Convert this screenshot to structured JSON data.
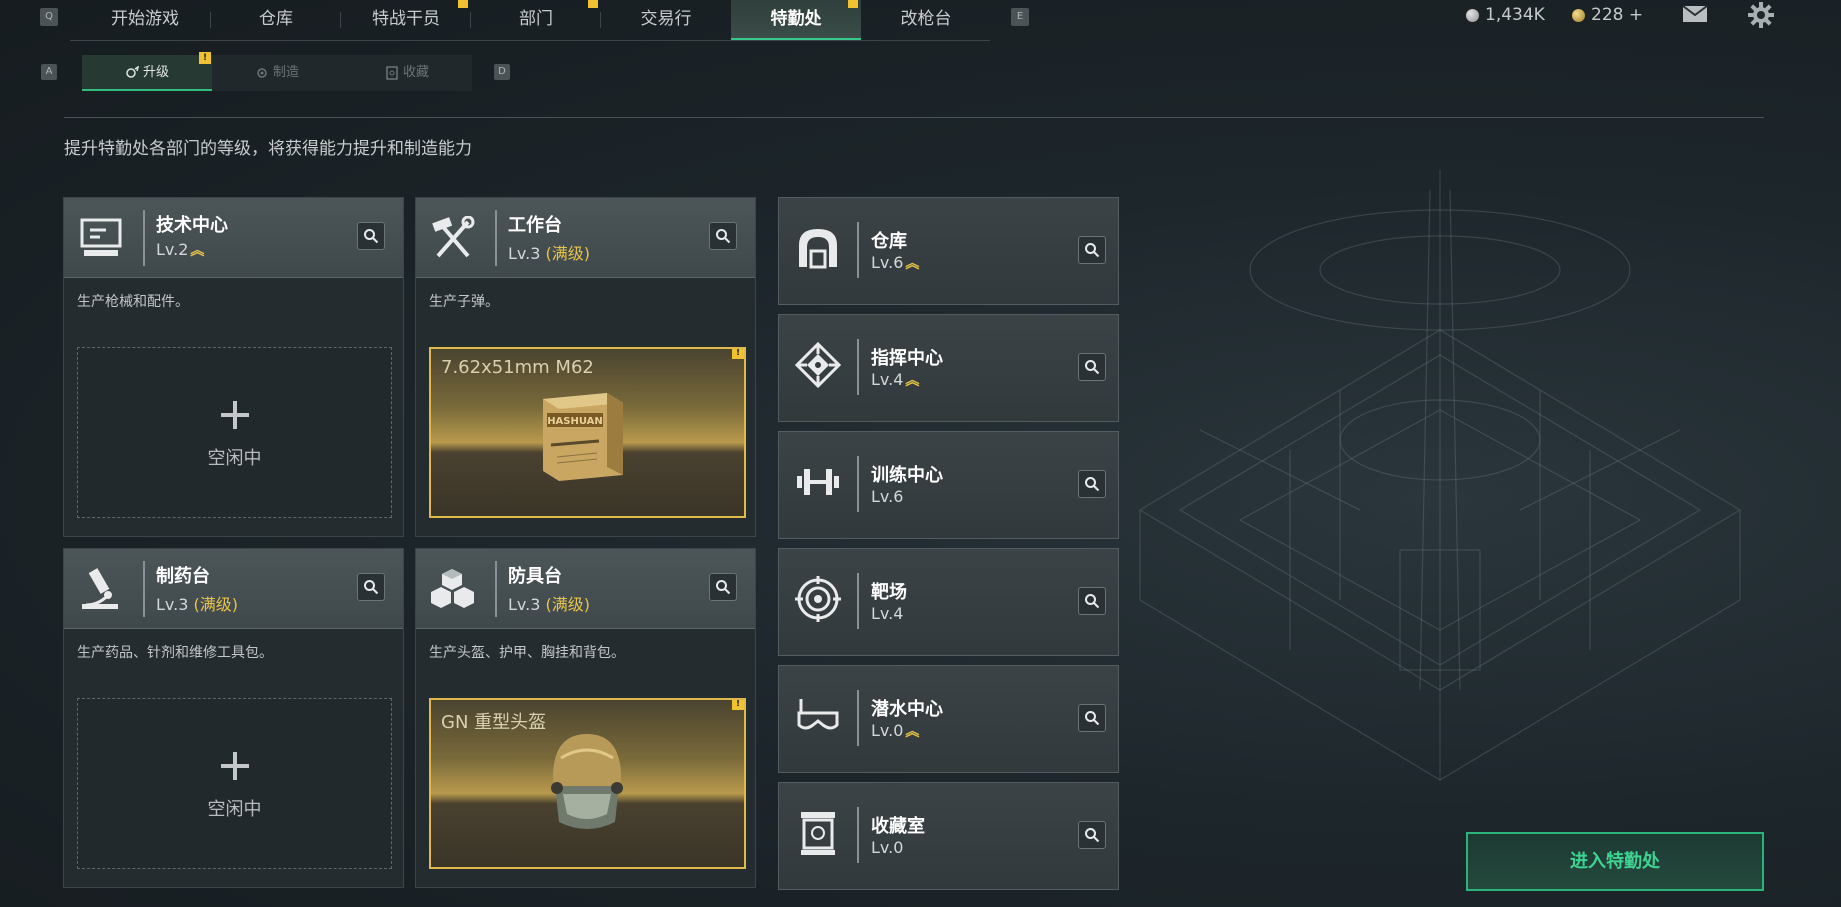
{
  "nav": {
    "key_left": "Q",
    "key_right": "E",
    "tabs": [
      {
        "label": "开始游戏",
        "notif": false
      },
      {
        "label": "仓库",
        "notif": false
      },
      {
        "label": "特战干员",
        "notif": true
      },
      {
        "label": "部门",
        "notif": true
      },
      {
        "label": "交易行",
        "notif": false
      },
      {
        "label": "特勤处",
        "notif": true,
        "active": true
      },
      {
        "label": "改枪台",
        "notif": false
      }
    ]
  },
  "currency": {
    "coins": "1,434K",
    "premium": "228 +"
  },
  "top_icons": [
    "mail-icon",
    "gear-icon"
  ],
  "subtabs": {
    "key_left": "A",
    "key_right": "D",
    "items": [
      {
        "label": "升级",
        "icon": "upgrade-icon",
        "active": true,
        "notif": true
      },
      {
        "label": "制造",
        "icon": "craft-icon",
        "active": false
      },
      {
        "label": "收藏",
        "icon": "collection-icon",
        "active": false
      }
    ]
  },
  "description": "提升特勤处各部门的等级，将获得能力提升和制造能力",
  "production_departments": [
    {
      "name": "技术中心",
      "level": "Lv.2",
      "max_label": "",
      "upgradable": true,
      "icon": "computer-icon",
      "desc": "生产枪械和配件。",
      "status": "idle",
      "idle_label": "空闲中",
      "product": ""
    },
    {
      "name": "工作台",
      "level": "Lv.3",
      "max_label": "(满级)",
      "upgradable": false,
      "icon": "hammer-wrench-icon",
      "desc": "生产子弹。",
      "status": "producing",
      "idle_label": "",
      "product": "7.62x51mm M62"
    },
    {
      "name": "制药台",
      "level": "Lv.3",
      "max_label": "(满级)",
      "upgradable": false,
      "icon": "microscope-icon",
      "desc": "生产药品、针剂和维修工具包。",
      "status": "idle",
      "idle_label": "空闲中",
      "product": ""
    },
    {
      "name": "防具台",
      "level": "Lv.3",
      "max_label": "(满级)",
      "upgradable": false,
      "icon": "cubes-icon",
      "desc": "生产头盔、护甲、胸挂和背包。",
      "status": "producing",
      "idle_label": "",
      "product": "GN 重型头盔"
    }
  ],
  "other_departments": [
    {
      "name": "仓库",
      "level": "Lv.6",
      "upgradable": true,
      "icon": "warehouse-icon"
    },
    {
      "name": "指挥中心",
      "level": "Lv.4",
      "upgradable": true,
      "icon": "command-icon"
    },
    {
      "name": "训练中心",
      "level": "Lv.6",
      "upgradable": false,
      "icon": "dumbbell-icon"
    },
    {
      "name": "靶场",
      "level": "Lv.4",
      "upgradable": false,
      "icon": "target-icon"
    },
    {
      "name": "潜水中心",
      "level": "Lv.0",
      "upgradable": true,
      "icon": "diving-mask-icon"
    },
    {
      "name": "收藏室",
      "level": "Lv.0",
      "upgradable": false,
      "icon": "collection-room-icon"
    }
  ],
  "ammo_box_label": "HASHUAN",
  "enter_button": "进入特勤处",
  "colors": {
    "accent_green": "#35c98a",
    "gold": "#e8c34a",
    "notification": "#f0c233"
  }
}
